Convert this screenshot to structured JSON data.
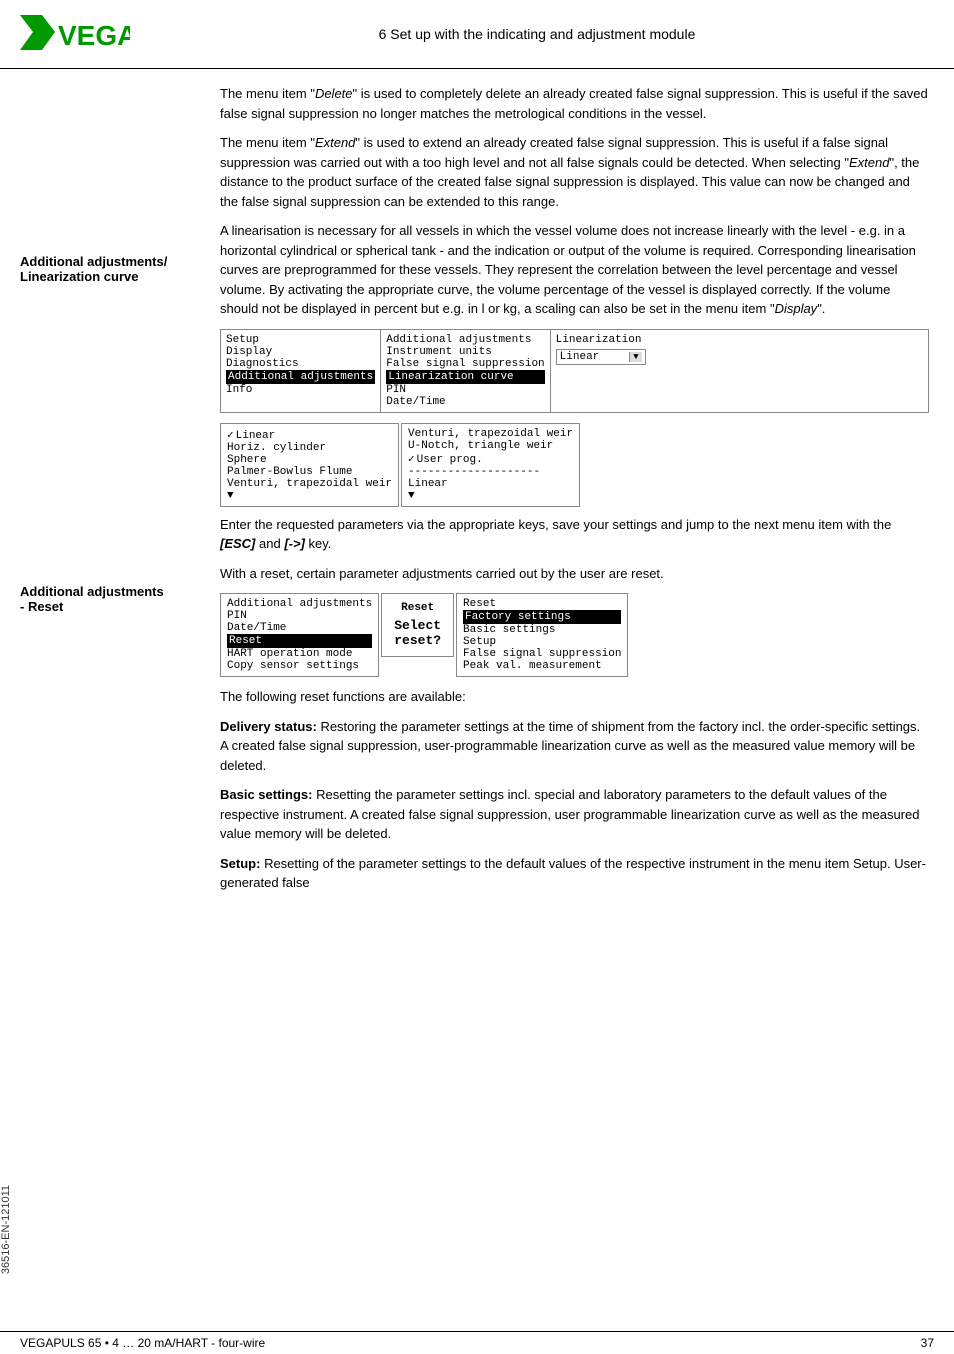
{
  "header": {
    "title": "6 Set up with the indicating and adjustment module",
    "logo": "VEGA"
  },
  "paragraphs": {
    "delete_p1": "The menu item \"Delete\" is used to completely delete an already created false signal suppression. This is useful if the saved false signal suppression no longer matches the metrological conditions in the vessel.",
    "extend_p1": "The menu item \"Extend\" is used to extend an already created false signal suppression. This is useful if a false signal suppression was carried out with a too high level and not all false signals could be detected. When selecting \"Extend\", the distance to the product surface of the created false signal suppression is displayed. This value can now be changed and the false signal suppression can be extended to this range.",
    "linearization_sidebar_label": "Additional adjustments/ Linearization curve",
    "linearization_p1": "A linearisation is necessary for all vessels in which the vessel volume does not increase linearly with the level - e.g. in a horizontal cylindrical or spherical tank - and the indication or output of the volume is required. Corresponding linearisation curves are preprogrammed for these vessels. They represent the correlation between the level percentage and vessel volume. By activating the appropriate curve, the volume percentage of the vessel is displayed correctly. If the volume should not be displayed in percent but e.g. in l or kg, a scaling can be also set in the menu item \"Display\".",
    "enter_keys": "Enter the requested parameters via the appropriate keys, save your settings and jump to the next menu item with the [ESC] and [->] key.",
    "reset_sidebar_label": "Additional adjustments - Reset",
    "reset_p1": "With a reset, certain parameter adjustments carried out by the user are reset.",
    "reset_available": "The following reset functions are available:",
    "delivery_status_label": "Delivery status:",
    "delivery_status_text": "Restoring the parameter settings at the time of shipment from the factory incl. the order-specific settings. A created false signal suppression, user-programmable linearization curve as well as the measured value memory will be deleted.",
    "basic_settings_label": "Basic settings:",
    "basic_settings_text": "Resetting the parameter settings incl. special and laboratory parameters to the default values of the respective instrument. A created false signal suppression, user programmable linearization curve as well as the measured value memory will be deleted.",
    "setup_label": "Setup:",
    "setup_text": "Resetting of the parameter settings to the default values of the respective instrument in the menu item Setup. User-generated false"
  },
  "menu1": {
    "col1": {
      "items": [
        "Setup",
        "Display",
        "Diagnostics",
        "Additional adjustments",
        "Info"
      ],
      "highlighted": "Additional adjustments"
    },
    "col2": {
      "header": "Additional adjustments",
      "items": [
        "Instrument units",
        "False signal suppression",
        "Linearization curve",
        "PIN",
        "Date/Time"
      ],
      "highlighted": "Linearization curve"
    },
    "col3": {
      "header": "Linearization",
      "dropdown_value": "Linear"
    }
  },
  "menu2": {
    "col1": {
      "items": [
        "Linear",
        "Horiz. cylinder",
        "Sphere",
        "Palmer-Bowlus Flume",
        "Venturi, trapezoidal weir"
      ],
      "checked": "Linear"
    },
    "col2": {
      "items": [
        "Venturi, trapezoidal weir",
        "U-Notch, triangle weir",
        "User prog.",
        "--------------------",
        "Linear"
      ],
      "checked": "User prog."
    }
  },
  "reset_menu": {
    "col1": {
      "header": "Additional adjustments",
      "items": [
        "PIN",
        "Date/Time",
        "Reset",
        "HART operation mode",
        "Copy sensor settings"
      ],
      "highlighted": "Reset"
    },
    "col2": {
      "label": "Reset",
      "line1": "Select",
      "line2": "reset?"
    },
    "col3": {
      "header": "Reset",
      "items": [
        "Factory settings",
        "Basic settings",
        "Setup",
        "False signal suppression",
        "Peak val. measurement"
      ],
      "highlighted": "Factory settings"
    }
  },
  "footer": {
    "left": "VEGAPULS 65 • 4 … 20 mA/HART - four-wire",
    "right": "37"
  },
  "vertical_text": "36516-EN-121011"
}
